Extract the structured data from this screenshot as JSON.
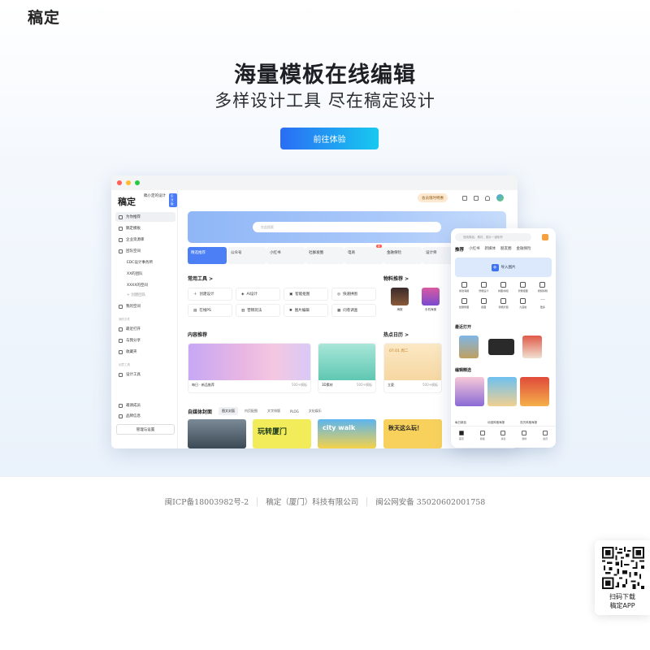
{
  "header": {
    "logo": "稿定"
  },
  "hero": {
    "headline": "海量模板在线编辑",
    "subline": "多样设计工具  尽在稿定设计",
    "cta_label": "前往体验"
  },
  "desktop": {
    "sidebar": {
      "logo": "稿定",
      "user": "稿小定的设计",
      "badge": "企业版",
      "items": [
        {
          "label": "为你推荐",
          "active": true
        },
        {
          "label": "稿定模板"
        },
        {
          "label": "企业资源库"
        },
        {
          "label": "团队空间"
        },
        {
          "label": "EDC设计事务所"
        },
        {
          "label": "XX的团队"
        },
        {
          "label": "XXXX的空间"
        },
        {
          "label": "+ 创建团队"
        },
        {
          "label": "我的空间"
        },
        {
          "label": "最近打开"
        },
        {
          "label": "与我分享"
        },
        {
          "label": "收藏夹"
        },
        {
          "label": "设计工具"
        },
        {
          "label": "邀请成员"
        },
        {
          "label": "品牌信息"
        }
      ],
      "section_labels": [
        "我的文件",
        "创意工具"
      ],
      "manage_button": "管理与设置"
    },
    "topbar": {
      "vip": "会员限时特惠"
    },
    "banner": {
      "search_placeholder": "在此搜索"
    },
    "categories": [
      {
        "label": "精选推荐",
        "active": true
      },
      {
        "label": "公众号"
      },
      {
        "label": "小红书"
      },
      {
        "label": "社群发圈"
      },
      {
        "label": "电商",
        "tag": "新"
      },
      {
        "label": "金融保险"
      },
      {
        "label": "设计师"
      }
    ],
    "tools_title": "常用工具 >",
    "tools": [
      "创建设计",
      "AI设计",
      "智能抠图",
      "快速拼图",
      "在线PS",
      "营销玩法",
      "图片编辑",
      "问卷调查"
    ],
    "materials_title": "物料推荐 >",
    "materials": [
      "海报",
      "手机海报"
    ],
    "content_title": "内容推荐",
    "content_cards": [
      {
        "label": "每日 · 新品推荐",
        "meta": "500+模板"
      },
      {
        "label": "3D素材",
        "meta": "500+模板"
      },
      {
        "label": "立夏",
        "meta": "500+模板"
      }
    ],
    "calendar_title": "热点日历 >",
    "calendar_date": "07.01 周二",
    "cover_title": "自媒体封面",
    "cover_tabs": [
      "图文封面",
      "内页配图",
      "文字排版",
      "PLOG",
      "文化娱乐"
    ],
    "thumb_texts": [
      "玩转厦门",
      "city walk",
      "秋天这么玩！"
    ]
  },
  "phone": {
    "search_placeholder": "搜索模板、素材、图片一键制作",
    "tabs": [
      "推荐",
      "小红书",
      "新媒体",
      "朋友圈",
      "金融保险"
    ],
    "import_label": "导入图片",
    "grid": [
      "新建海报",
      "智能设计",
      "拼图/拼接",
      "智能抠图",
      "视频剪辑",
      "批量修图",
      "抠图",
      "智能扩图",
      "九宫格",
      "更多"
    ],
    "recent_title": "最近打开",
    "picks_title": "编辑精选",
    "picks_labels": [
      "每日新品",
      "动漫风格海报",
      "农历风格海报"
    ],
    "nav": [
      "首页",
      "模板",
      "消息",
      "我的",
      "会员"
    ]
  },
  "footer": {
    "icp": "闽ICP备18003982号-2",
    "company": "稿定（厦门）科技有限公司",
    "police": "闽公网安备 35020602001758"
  },
  "qr": {
    "line1": "扫码下载",
    "line2": "稿定APP"
  }
}
